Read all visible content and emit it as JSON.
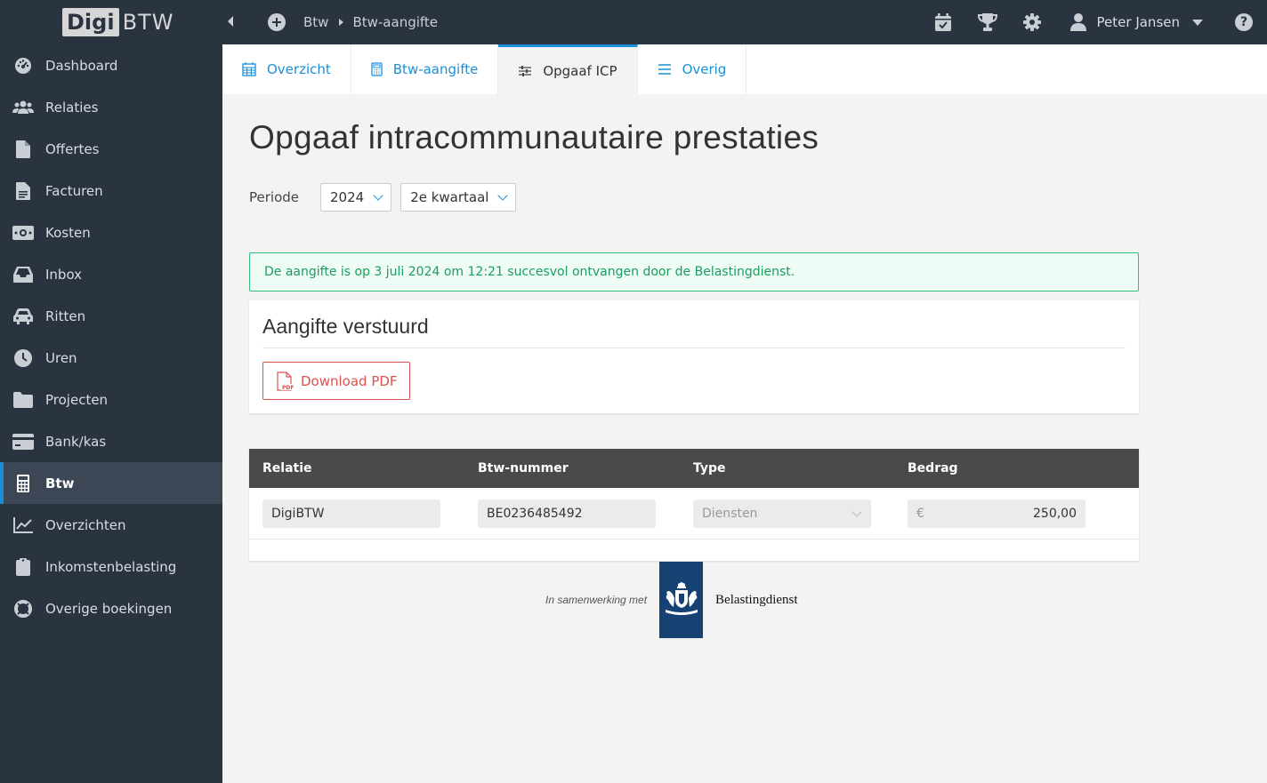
{
  "brand": {
    "digi": "Digi",
    "btw": "BTW"
  },
  "sidebar": {
    "items": [
      {
        "label": "Dashboard",
        "icon": "dashboard-icon"
      },
      {
        "label": "Relaties",
        "icon": "users-icon"
      },
      {
        "label": "Offertes",
        "icon": "file-icon"
      },
      {
        "label": "Facturen",
        "icon": "invoice-icon"
      },
      {
        "label": "Kosten",
        "icon": "money-icon"
      },
      {
        "label": "Inbox",
        "icon": "inbox-icon"
      },
      {
        "label": "Ritten",
        "icon": "car-icon"
      },
      {
        "label": "Uren",
        "icon": "clock-icon"
      },
      {
        "label": "Projecten",
        "icon": "folder-icon"
      },
      {
        "label": "Bank/kas",
        "icon": "credit-card-icon"
      },
      {
        "label": "Btw",
        "icon": "calculator-icon",
        "active": true
      },
      {
        "label": "Overzichten",
        "icon": "line-chart-icon"
      },
      {
        "label": "Inkomstenbelasting",
        "icon": "clipboard-icon"
      },
      {
        "label": "Overige boekingen",
        "icon": "lifebuoy-icon"
      }
    ]
  },
  "topbar": {
    "breadcrumb": [
      "Btw",
      "Btw-aangifte"
    ],
    "user_name": "Peter Jansen"
  },
  "tabs": [
    {
      "label": "Overzicht",
      "icon": "calendar-grid-icon"
    },
    {
      "label": "Btw-aangifte",
      "icon": "calculator-icon"
    },
    {
      "label": "Opgaaf ICP",
      "icon": "sliders-icon",
      "active": true
    },
    {
      "label": "Overig",
      "icon": "menu-icon"
    }
  ],
  "main": {
    "title": "Opgaaf intracommunautaire prestaties",
    "period_label": "Periode",
    "year": "2024",
    "quarter": "2e kwartaal",
    "alert": "De aangifte is op 3 juli 2024 om 12:21 succesvol ontvangen door de Belastingdienst.",
    "card_title": "Aangifte verstuurd",
    "download_label": "Download PDF"
  },
  "table": {
    "headers": [
      "Relatie",
      "Btw-nummer",
      "Type",
      "Bedrag"
    ],
    "rows": [
      {
        "relatie": "DigiBTW",
        "btw_nummer": "BE0236485492",
        "type": "Diensten",
        "currency": "€",
        "bedrag": "250,00"
      }
    ]
  },
  "footer": {
    "partner_text": "In samenwerking met",
    "partner_name": "Belastingdienst"
  },
  "colors": {
    "sidebar": "#2a3440",
    "accent": "#1b8fd6",
    "success": "#2fc07c",
    "danger": "#d9534f",
    "table_head": "#4a4a4a"
  }
}
